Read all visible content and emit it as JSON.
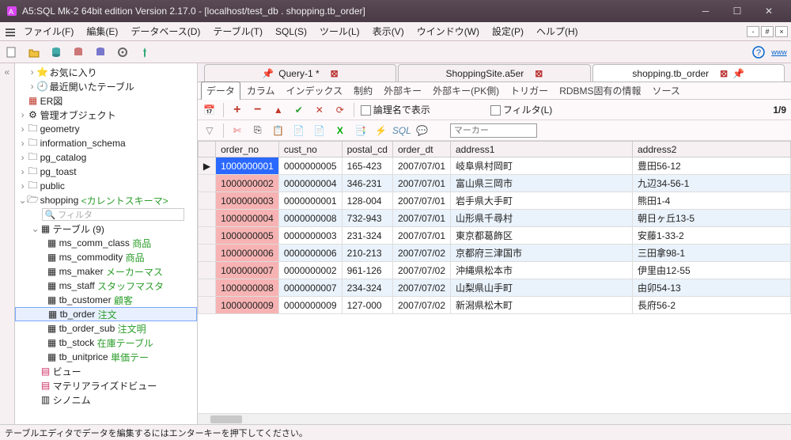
{
  "window": {
    "title": "A5:SQL Mk-2 64bit edition Version 2.17.0 - [localhost/test_db . shopping.tb_order]"
  },
  "menu": {
    "file": "ファイル(F)",
    "edit": "編集(E)",
    "database": "データベース(D)",
    "table": "テーブル(T)",
    "sql": "SQL(S)",
    "tool": "ツール(L)",
    "view": "表示(V)",
    "window": "ウインドウ(W)",
    "settings": "設定(P)",
    "help": "ヘルプ(H)"
  },
  "sidebar": {
    "favorites": "お気に入り",
    "recent": "最近開いたテーブル",
    "er": "ER図",
    "adminobj": "管理オブジェクト",
    "schemas": {
      "geometry": "geometry",
      "info": "information_schema",
      "pgcat": "pg_catalog",
      "pgtoast": "pg_toast",
      "public": "public",
      "shopping": "shopping",
      "shopping_note": "<カレントスキーマ>",
      "filter_placeholder": "フィルタ",
      "tables_label": "テーブル (9)",
      "tables": [
        {
          "name": "ms_comm_class",
          "c": "商品"
        },
        {
          "name": "ms_commodity",
          "c": "商品"
        },
        {
          "name": "ms_maker",
          "c": "メーカーマス"
        },
        {
          "name": "ms_staff",
          "c": "スタッフマスタ"
        },
        {
          "name": "tb_customer",
          "c": "顧客"
        },
        {
          "name": "tb_order",
          "c": "注文"
        },
        {
          "name": "tb_order_sub",
          "c": "注文明"
        },
        {
          "name": "tb_stock",
          "c": "在庫テーブル"
        },
        {
          "name": "tb_unitprice",
          "c": "単価テー"
        }
      ],
      "view": "ビュー",
      "matview": "マテリアライズドビュー",
      "synonym": "シノニム"
    }
  },
  "doctabs": [
    {
      "label": "Query-1 *",
      "active": false,
      "dirty": true
    },
    {
      "label": "ShoppingSite.a5er",
      "active": false
    },
    {
      "label": "shopping.tb_order",
      "active": true
    }
  ],
  "subtabs": [
    "データ",
    "カラム",
    "インデックス",
    "制約",
    "外部キー",
    "外部キー(PK側)",
    "トリガー",
    "RDBMS固有の情報",
    "ソース"
  ],
  "gridbar": {
    "logical": "論理名で表示",
    "filter": "フィルタ(L)",
    "page": "1/9"
  },
  "gridtools": {
    "marker_placeholder": "マーカー",
    "sql_label": "SQL"
  },
  "columns": [
    "order_no",
    "cust_no",
    "postal_cd",
    "order_dt",
    "address1",
    "address2"
  ],
  "rows": [
    {
      "order_no": "1000000001",
      "cust_no": "0000000005",
      "postal_cd": "165-423",
      "order_dt": "2007/07/01",
      "address1": "岐阜県村岡町",
      "address2": "豊田56-12",
      "sel": true
    },
    {
      "order_no": "1000000002",
      "cust_no": "0000000004",
      "postal_cd": "346-231",
      "order_dt": "2007/07/01",
      "address1": "富山県三岡市",
      "address2": "九辺34-56-1",
      "alt": true
    },
    {
      "order_no": "1000000003",
      "cust_no": "0000000001",
      "postal_cd": "128-004",
      "order_dt": "2007/07/01",
      "address1": "岩手県大手町",
      "address2": "熊田1-4"
    },
    {
      "order_no": "1000000004",
      "cust_no": "0000000008",
      "postal_cd": "732-943",
      "order_dt": "2007/07/01",
      "address1": "山形県千尋村",
      "address2": "朝日ヶ丘13-5",
      "alt": true
    },
    {
      "order_no": "1000000005",
      "cust_no": "0000000003",
      "postal_cd": "231-324",
      "order_dt": "2007/07/01",
      "address1": "東京都葛飾区",
      "address2": "安藤1-33-2"
    },
    {
      "order_no": "1000000006",
      "cust_no": "0000000006",
      "postal_cd": "210-213",
      "order_dt": "2007/07/02",
      "address1": "京都府三津国市",
      "address2": "三田拿98-1",
      "alt": true
    },
    {
      "order_no": "1000000007",
      "cust_no": "0000000002",
      "postal_cd": "961-126",
      "order_dt": "2007/07/02",
      "address1": "沖縄県松本市",
      "address2": "伊里由12-55"
    },
    {
      "order_no": "1000000008",
      "cust_no": "0000000007",
      "postal_cd": "234-324",
      "order_dt": "2007/07/02",
      "address1": "山梨県山手町",
      "address2": "由卯54-13",
      "alt": true
    },
    {
      "order_no": "1000000009",
      "cust_no": "0000000009",
      "postal_cd": "127-000",
      "order_dt": "2007/07/02",
      "address1": "新潟県松木町",
      "address2": "長府56-2"
    }
  ],
  "status": "テーブルエディタでデータを編集するにはエンターキーを押下してください。"
}
